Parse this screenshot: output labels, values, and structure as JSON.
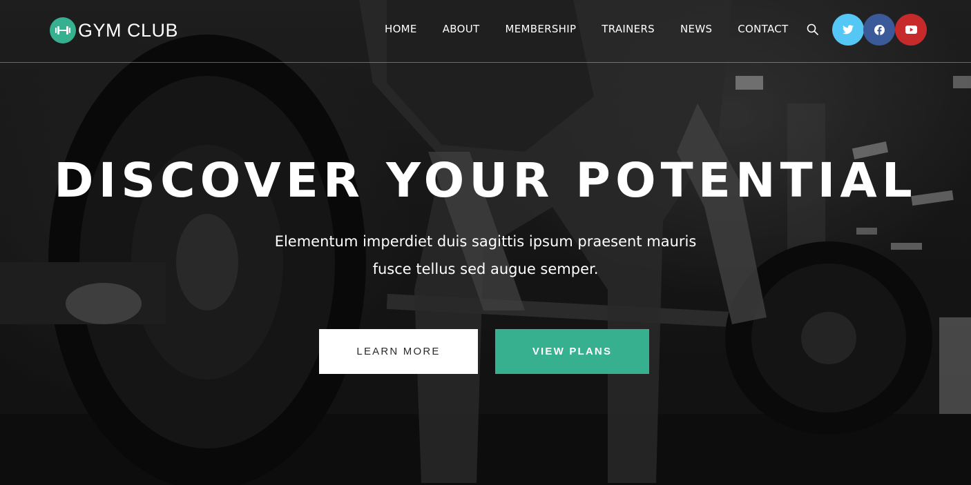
{
  "brand": {
    "name": "GYM CLUB",
    "logo_icon": "dumbbell-icon",
    "accent_color": "#36b08f"
  },
  "nav": {
    "items": [
      {
        "label": "HOME"
      },
      {
        "label": "ABOUT"
      },
      {
        "label": "MEMBERSHIP"
      },
      {
        "label": "TRAINERS"
      },
      {
        "label": "NEWS"
      },
      {
        "label": "CONTACT"
      }
    ],
    "search_icon": "search-icon"
  },
  "social": [
    {
      "name": "twitter",
      "icon": "twitter-icon",
      "color": "#55c7f5"
    },
    {
      "name": "facebook",
      "icon": "facebook-icon",
      "color": "#3b5a9a"
    },
    {
      "name": "youtube",
      "icon": "youtube-icon",
      "color": "#c62a2a"
    }
  ],
  "hero": {
    "headline": "DISCOVER YOUR POTENTIAL",
    "subtitle_line1": "Elementum imperdiet duis sagittis ipsum praesent mauris",
    "subtitle_line2": "fusce tellus sed augue semper.",
    "primary_button": "LEARN MORE",
    "secondary_button": "VIEW PLANS",
    "secondary_button_color": "#36b08f"
  }
}
